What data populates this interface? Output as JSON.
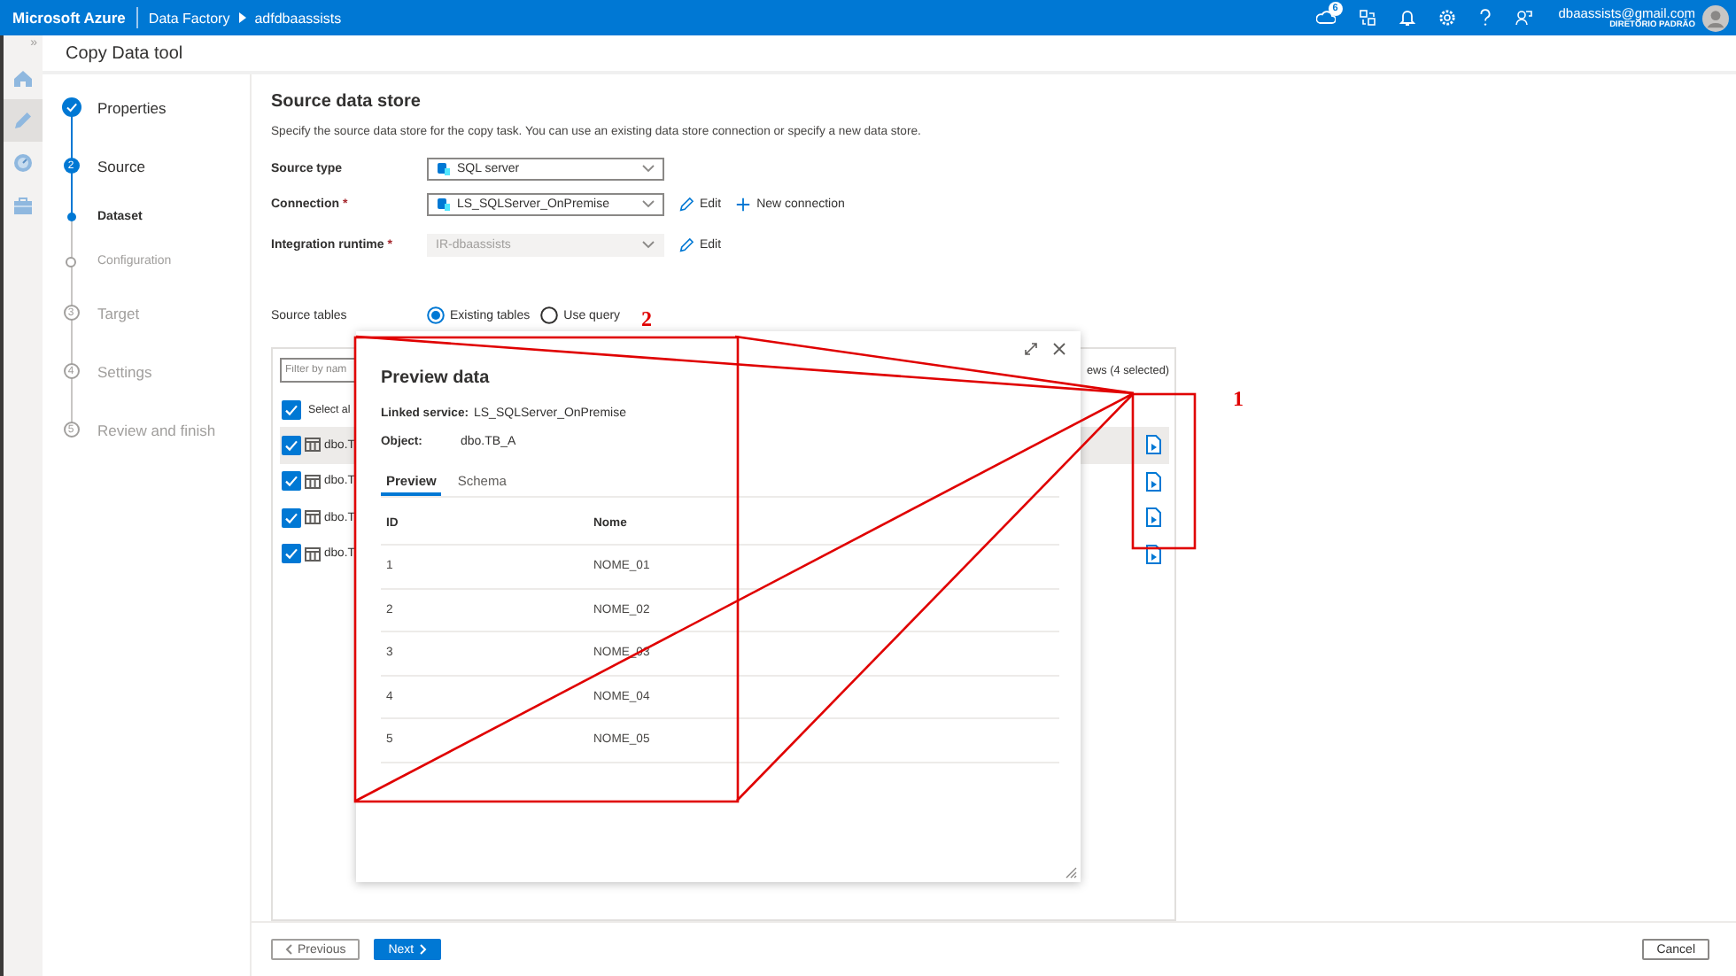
{
  "topbar": {
    "brand": "Microsoft Azure",
    "breadcrumb": [
      "Data Factory",
      "adfdbaassists"
    ],
    "badge": "6",
    "account": {
      "email": "dbaassists@gmail.com",
      "directory": "DIRETÓRIO PADRÃO"
    }
  },
  "rail": {
    "toggle": "»",
    "items": [
      {
        "kind": "home",
        "selected": false
      },
      {
        "kind": "author",
        "selected": true
      },
      {
        "kind": "monitor",
        "selected": false
      },
      {
        "kind": "manage",
        "selected": false
      }
    ]
  },
  "title": "Copy Data tool",
  "steps": [
    {
      "label": "Properties",
      "done": true,
      "current": false
    },
    {
      "label": "Source",
      "number": "2",
      "done": false,
      "current": true,
      "children": [
        {
          "label": "Dataset",
          "done": false,
          "current": true
        },
        {
          "label": "Configuration",
          "done": false,
          "current": false
        }
      ]
    },
    {
      "label": "Target",
      "number": "3",
      "done": false,
      "current": false
    },
    {
      "label": "Settings",
      "number": "4",
      "done": false,
      "current": false
    },
    {
      "label": "Review and finish",
      "number": "5",
      "done": false,
      "current": false
    }
  ],
  "source": {
    "heading": "Source data store",
    "description": "Specify the source data store for the copy task. You can use an existing data store connection or specify a new data store.",
    "fields": [
      {
        "label": "Source type",
        "value": "SQL server",
        "disabled": false
      },
      {
        "label": "Connection",
        "required_mark": "*",
        "value": "LS_SQLServer_OnPremise",
        "disabled": false,
        "actions": [
          {
            "kind": "edit",
            "label": "Edit"
          },
          {
            "kind": "new",
            "label": "New connection"
          }
        ]
      },
      {
        "label": "Integration runtime",
        "required_mark": "*",
        "value": "IR-dbaassists",
        "disabled": true,
        "actions": [
          {
            "kind": "edit",
            "label": "Edit"
          }
        ]
      }
    ],
    "source_tables": {
      "label": "Source tables",
      "options": [
        {
          "label": "Existing tables",
          "selected": true
        },
        {
          "label": "Use query",
          "selected": false
        }
      ]
    },
    "tables": {
      "filter_placeholder": "Filter by nam",
      "select_all": {
        "label": "Select al",
        "checked": true
      },
      "summary": "ews (4 selected)",
      "rows": [
        {
          "name": "dbo.T",
          "checked": true,
          "selected": true
        },
        {
          "name": "dbo.T",
          "checked": true,
          "selected": false
        },
        {
          "name": "dbo.T",
          "checked": true,
          "selected": false
        },
        {
          "name": "dbo.T",
          "checked": true,
          "selected": false
        }
      ]
    }
  },
  "preview": {
    "title": "Preview data",
    "linked_service_label": "Linked service:",
    "linked_service": "LS_SQLServer_OnPremise",
    "object_label": "Object:",
    "object": "dbo.TB_A",
    "tabs": [
      {
        "label": "Preview",
        "selected": true
      },
      {
        "label": "Schema",
        "selected": false
      }
    ],
    "columns": [
      "ID",
      "Nome"
    ],
    "rows": [
      [
        "1",
        "NOME_01"
      ],
      [
        "2",
        "NOME_02"
      ],
      [
        "3",
        "NOME_03"
      ],
      [
        "4",
        "NOME_04"
      ],
      [
        "5",
        "NOME_05"
      ]
    ]
  },
  "footer": {
    "buttons": [
      {
        "kind": "previous",
        "label": "Previous",
        "disabled": true
      },
      {
        "kind": "next",
        "label": "Next",
        "disabled": false
      },
      {
        "kind": "cancel",
        "label": "Cancel",
        "disabled": false
      }
    ]
  },
  "annotations": [
    {
      "label": "2"
    },
    {
      "label": "1"
    }
  ]
}
